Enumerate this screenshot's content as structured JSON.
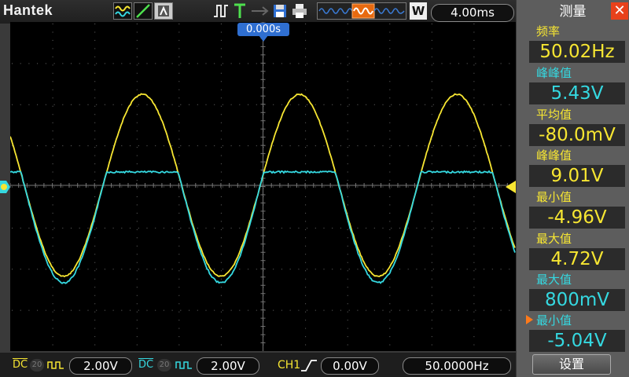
{
  "brand": "Hantek",
  "toolbar": {
    "w_label": "W",
    "timebase": "4.00ms"
  },
  "screen": {
    "trigger_position": "0.000s"
  },
  "bottom": {
    "ch1_coupling": "DC",
    "ch1_probe": "20",
    "ch1_volts": "2.00V",
    "ch2_coupling": "DC",
    "ch2_probe": "20",
    "ch2_volts": "2.00V",
    "trigger_source": "CH1",
    "trigger_level": "0.00V",
    "trigger_freq": "50.0000Hz"
  },
  "panel": {
    "title": "测量",
    "settings_label": "设置",
    "items": [
      {
        "label": "频率",
        "value": "50.02Hz",
        "channel": "ch1"
      },
      {
        "label": "峰峰值",
        "value": "5.43V",
        "channel": "ch2"
      },
      {
        "label": "平均值",
        "value": "-80.0mV",
        "channel": "ch1"
      },
      {
        "label": "峰峰值",
        "value": "9.01V",
        "channel": "ch1"
      },
      {
        "label": "最小值",
        "value": "-4.96V",
        "channel": "ch1"
      },
      {
        "label": "最大值",
        "value": "4.72V",
        "channel": "ch1"
      },
      {
        "label": "最大值",
        "value": "800mV",
        "channel": "ch2"
      },
      {
        "label": "最小值",
        "value": "-5.04V",
        "channel": "ch2",
        "selected": true
      }
    ]
  },
  "colors": {
    "ch1": "#f7e632",
    "ch2": "#35d8e0",
    "selected_marker": "#ff7a1a",
    "accent_blue": "#2f6fd1"
  }
}
